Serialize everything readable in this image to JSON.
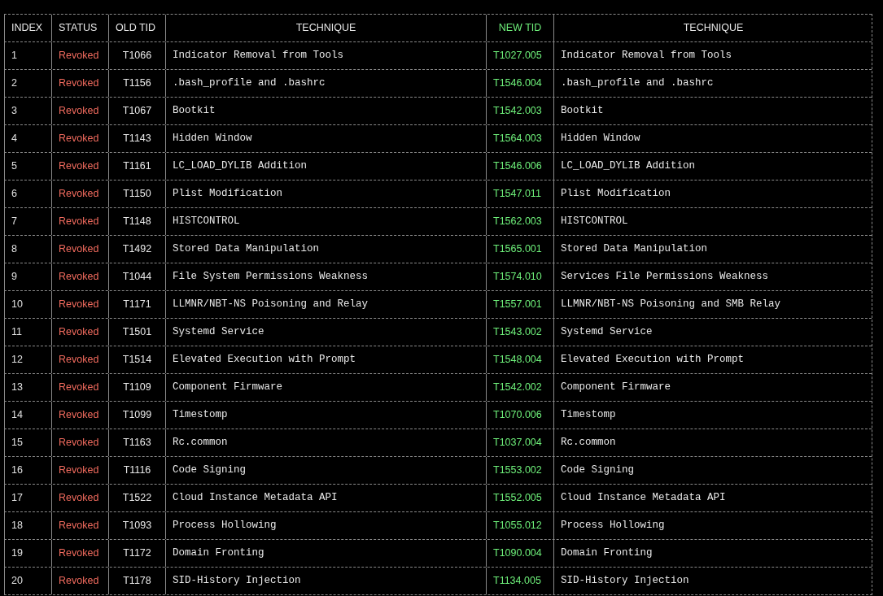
{
  "table": {
    "columns": [
      "INDEX",
      "STATUS",
      "OLD TID",
      "TECHNIQUE",
      "NEW TID",
      "TECHNIQUE"
    ],
    "rows": [
      {
        "index": "1",
        "status": "Revoked",
        "old_tid": "T1066",
        "old_technique": "Indicator Removal from Tools",
        "new_tid": "T1027.005",
        "new_technique": "Indicator Removal from Tools"
      },
      {
        "index": "2",
        "status": "Revoked",
        "old_tid": "T1156",
        "old_technique": ".bash_profile and .bashrc",
        "new_tid": "T1546.004",
        "new_technique": ".bash_profile and .bashrc"
      },
      {
        "index": "3",
        "status": "Revoked",
        "old_tid": "T1067",
        "old_technique": "Bootkit",
        "new_tid": "T1542.003",
        "new_technique": "Bootkit"
      },
      {
        "index": "4",
        "status": "Revoked",
        "old_tid": "T1143",
        "old_technique": "Hidden Window",
        "new_tid": "T1564.003",
        "new_technique": "Hidden Window"
      },
      {
        "index": "5",
        "status": "Revoked",
        "old_tid": "T1161",
        "old_technique": "LC_LOAD_DYLIB Addition",
        "new_tid": "T1546.006",
        "new_technique": "LC_LOAD_DYLIB Addition"
      },
      {
        "index": "6",
        "status": "Revoked",
        "old_tid": "T1150",
        "old_technique": "Plist Modification",
        "new_tid": "T1547.011",
        "new_technique": "Plist Modification"
      },
      {
        "index": "7",
        "status": "Revoked",
        "old_tid": "T1148",
        "old_technique": "HISTCONTROL",
        "new_tid": "T1562.003",
        "new_technique": "HISTCONTROL"
      },
      {
        "index": "8",
        "status": "Revoked",
        "old_tid": "T1492",
        "old_technique": "Stored Data Manipulation",
        "new_tid": "T1565.001",
        "new_technique": "Stored Data Manipulation"
      },
      {
        "index": "9",
        "status": "Revoked",
        "old_tid": "T1044",
        "old_technique": "File System Permissions Weakness",
        "new_tid": "T1574.010",
        "new_technique": "Services File Permissions Weakness"
      },
      {
        "index": "10",
        "status": "Revoked",
        "old_tid": "T1171",
        "old_technique": "LLMNR/NBT-NS Poisoning and Relay",
        "new_tid": "T1557.001",
        "new_technique": "LLMNR/NBT-NS Poisoning and SMB Relay"
      },
      {
        "index": "11",
        "status": "Revoked",
        "old_tid": "T1501",
        "old_technique": "Systemd Service",
        "new_tid": "T1543.002",
        "new_technique": "Systemd Service"
      },
      {
        "index": "12",
        "status": "Revoked",
        "old_tid": "T1514",
        "old_technique": "Elevated Execution with Prompt",
        "new_tid": "T1548.004",
        "new_technique": "Elevated Execution with Prompt"
      },
      {
        "index": "13",
        "status": "Revoked",
        "old_tid": "T1109",
        "old_technique": "Component Firmware",
        "new_tid": "T1542.002",
        "new_technique": "Component Firmware"
      },
      {
        "index": "14",
        "status": "Revoked",
        "old_tid": "T1099",
        "old_technique": "Timestomp",
        "new_tid": "T1070.006",
        "new_technique": "Timestomp"
      },
      {
        "index": "15",
        "status": "Revoked",
        "old_tid": "T1163",
        "old_technique": "Rc.common",
        "new_tid": "T1037.004",
        "new_technique": "Rc.common"
      },
      {
        "index": "16",
        "status": "Revoked",
        "old_tid": "T1116",
        "old_technique": "Code Signing",
        "new_tid": "T1553.002",
        "new_technique": "Code Signing"
      },
      {
        "index": "17",
        "status": "Revoked",
        "old_tid": "T1522",
        "old_technique": "Cloud Instance Metadata API",
        "new_tid": "T1552.005",
        "new_technique": "Cloud Instance Metadata API"
      },
      {
        "index": "18",
        "status": "Revoked",
        "old_tid": "T1093",
        "old_technique": "Process Hollowing",
        "new_tid": "T1055.012",
        "new_technique": "Process Hollowing"
      },
      {
        "index": "19",
        "status": "Revoked",
        "old_tid": "T1172",
        "old_technique": "Domain Fronting",
        "new_tid": "T1090.004",
        "new_technique": "Domain Fronting"
      },
      {
        "index": "20",
        "status": "Revoked",
        "old_tid": "T1178",
        "old_technique": "SID-History Injection",
        "new_tid": "T1134.005",
        "new_technique": "SID-History Injection"
      }
    ]
  }
}
